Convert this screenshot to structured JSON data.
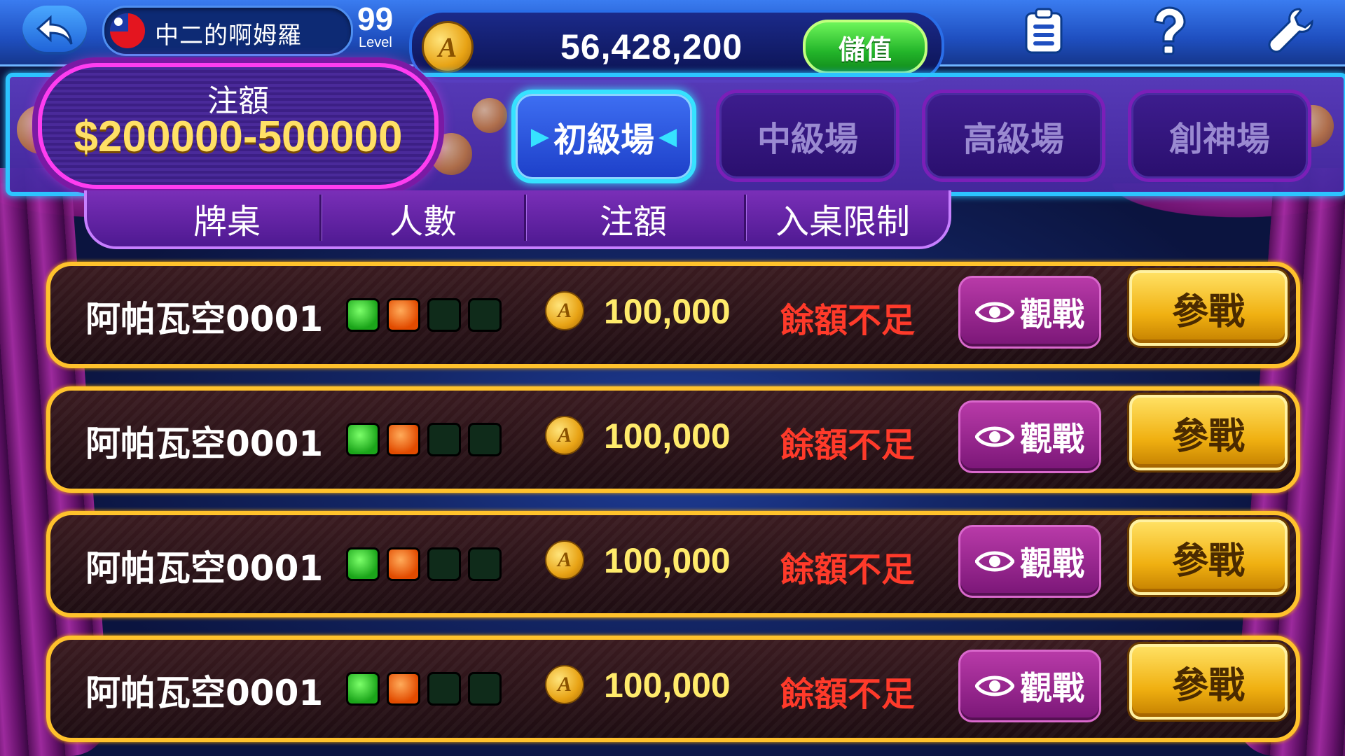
{
  "player": {
    "name": "中二的啊姆羅",
    "level_number": "99",
    "level_label": "Level"
  },
  "wallet": {
    "balance": "56,428,200",
    "deposit_label": "儲值",
    "coin_symbol": "A"
  },
  "bet_badge": {
    "label": "注額",
    "range": "$200000-500000"
  },
  "tabs": [
    {
      "label": "初級場",
      "active": true
    },
    {
      "label": "中級場",
      "active": false
    },
    {
      "label": "高級場",
      "active": false
    },
    {
      "label": "創神場",
      "active": false
    }
  ],
  "columns": [
    "牌桌",
    "人數",
    "注額",
    "入桌限制"
  ],
  "rows": [
    {
      "table": "阿帕瓦空0001",
      "seats": [
        "on",
        "busy",
        "empty",
        "empty"
      ],
      "bet": "100,000",
      "limit": "餘額不足",
      "watch": "觀戰",
      "join": "參戰"
    },
    {
      "table": "阿帕瓦空0001",
      "seats": [
        "on",
        "busy",
        "empty",
        "empty"
      ],
      "bet": "100,000",
      "limit": "餘額不足",
      "watch": "觀戰",
      "join": "參戰"
    },
    {
      "table": "阿帕瓦空0001",
      "seats": [
        "on",
        "busy",
        "empty",
        "empty"
      ],
      "bet": "100,000",
      "limit": "餘額不足",
      "watch": "觀戰",
      "join": "參戰"
    },
    {
      "table": "阿帕瓦空0001",
      "seats": [
        "on",
        "busy",
        "empty",
        "empty"
      ],
      "bet": "100,000",
      "limit": "餘額不足",
      "watch": "觀戰",
      "join": "參戰"
    }
  ],
  "icons": {
    "back": "back-arrow-icon",
    "flag": "flag-icon",
    "records": "clipboard-icon",
    "help": "question-icon",
    "settings": "wrench-icon",
    "watch": "eye-icon"
  },
  "colors": {
    "accent_cyan": "#36e2ff",
    "accent_magenta": "#ff3df0",
    "row_border_gold": "#ffc22c",
    "bet_yellow": "#ffeb6b",
    "warning_red": "#ff3a2a",
    "deposit_green": "#23b52a"
  }
}
